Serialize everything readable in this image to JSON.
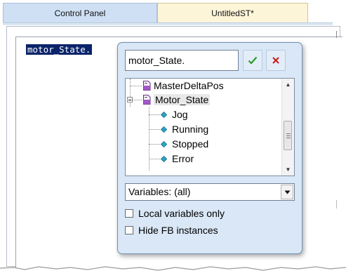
{
  "tabs": [
    {
      "label": "Control Panel"
    },
    {
      "label": "UntitledST*"
    }
  ],
  "editor": {
    "code_line": "motor_State."
  },
  "popup": {
    "search_value": "motor_State.",
    "tree": {
      "items": [
        {
          "label": "MasterDeltaPos",
          "icon": "document-icon"
        },
        {
          "label": "Motor_State",
          "icon": "document-icon",
          "expanded": true
        },
        {
          "label": "Jog",
          "icon": "diamond-icon"
        },
        {
          "label": "Running",
          "icon": "diamond-icon"
        },
        {
          "label": "Stopped",
          "icon": "diamond-icon"
        },
        {
          "label": "Error",
          "icon": "diamond-icon"
        }
      ]
    },
    "filter_select": "Variables: (all)",
    "local_only_label": "Local variables only",
    "hide_fb_label": "Hide FB instances",
    "local_only_checked": false,
    "hide_fb_checked": false
  },
  "colors": {
    "selection_bg": "#0a246a",
    "popup_bg": "#d9e7f6",
    "confirm_green": "#2a9a2a",
    "cancel_red": "#d01818"
  }
}
